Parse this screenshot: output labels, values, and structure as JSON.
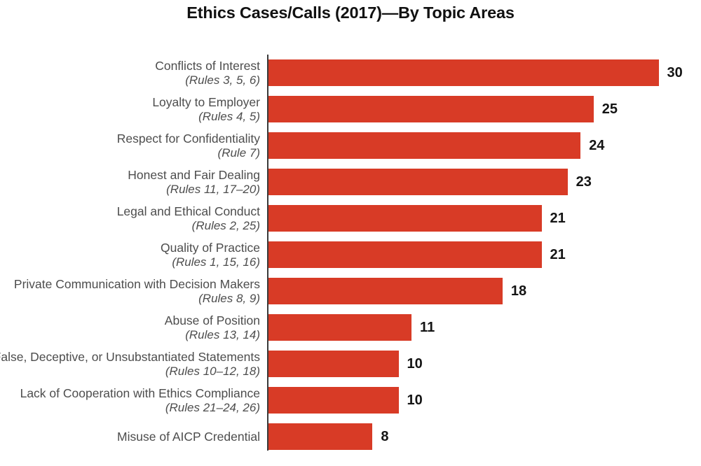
{
  "chart_data": {
    "type": "bar",
    "orientation": "horizontal",
    "title": "Ethics Cases/Calls (2017)—By Topic Areas",
    "xlabel": "",
    "ylabel": "",
    "xlim": [
      0,
      30
    ],
    "grid": false,
    "legend": false,
    "value_labels": true,
    "bar_color": "#d83b26",
    "label_color": "#4d4d4d",
    "value_label_color": "#141414",
    "axis_color": "#3a3a3a",
    "background": "#ffffff",
    "categories": [
      "Conflicts of Interest",
      "Loyalty to Employer",
      "Respect for Confidentiality",
      "Honest and Fair Dealing",
      "Legal and Ethical Conduct",
      "Quality of Practice",
      "Private Communication with Decision Makers",
      "Abuse of Position",
      "False, Deceptive, or Unsubstantiated Statements",
      "Lack of Cooperation with Ethics Compliance",
      "Misuse of AICP Credential"
    ],
    "category_sublabels": [
      "(Rules 3, 5, 6)",
      "(Rules 4, 5)",
      "(Rule 7)",
      "(Rules 11, 17–20)",
      "(Rules 2, 25)",
      "(Rules 1, 15, 16)",
      "(Rules 8, 9)",
      "(Rules 13, 14)",
      "(Rules 10–12, 18)",
      "(Rules 21–24, 26)",
      ""
    ],
    "values": [
      30,
      25,
      24,
      23,
      21,
      21,
      18,
      11,
      10,
      10,
      8
    ],
    "value_labels_text": [
      "30",
      "25",
      "24",
      "23",
      "21",
      "21",
      "18",
      "11",
      "10",
      "10",
      "8"
    ]
  }
}
